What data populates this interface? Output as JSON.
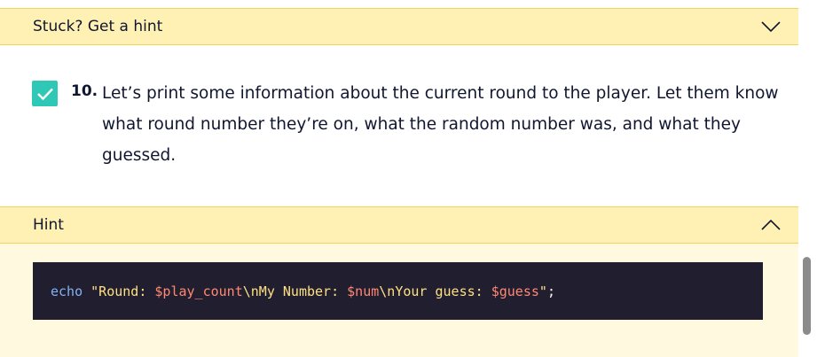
{
  "hint_collapsed": {
    "label": "Stuck? Get a hint",
    "state": "collapsed",
    "icon": "chevron-down-icon"
  },
  "task": {
    "completed": true,
    "check_icon": "checkmark-icon",
    "number": "10.",
    "text": "Let’s print some information about the current round to the player. Let them know what round number they’re on, what the random number was, and what they guessed."
  },
  "hint_expanded": {
    "label": "Hint",
    "state": "expanded",
    "icon": "chevron-up-icon"
  },
  "code": {
    "tokens": {
      "keyword": "echo",
      "space": " ",
      "str1": "\"Round: ",
      "var1": "$play_count",
      "str2": "\\nMy Number: ",
      "var2": "$num",
      "str3": "\\nYour guess: ",
      "var3": "$guess",
      "str4": "\"",
      "semicolon": ";"
    }
  },
  "colors": {
    "hint_background": "#fff0b3",
    "hint_border": "#f3d25c",
    "checkbox": "#2fc8b6",
    "code_background": "#211e2f",
    "code_keyword": "#83b3f3",
    "code_string": "#ffe083",
    "code_variable": "#ff8973"
  }
}
